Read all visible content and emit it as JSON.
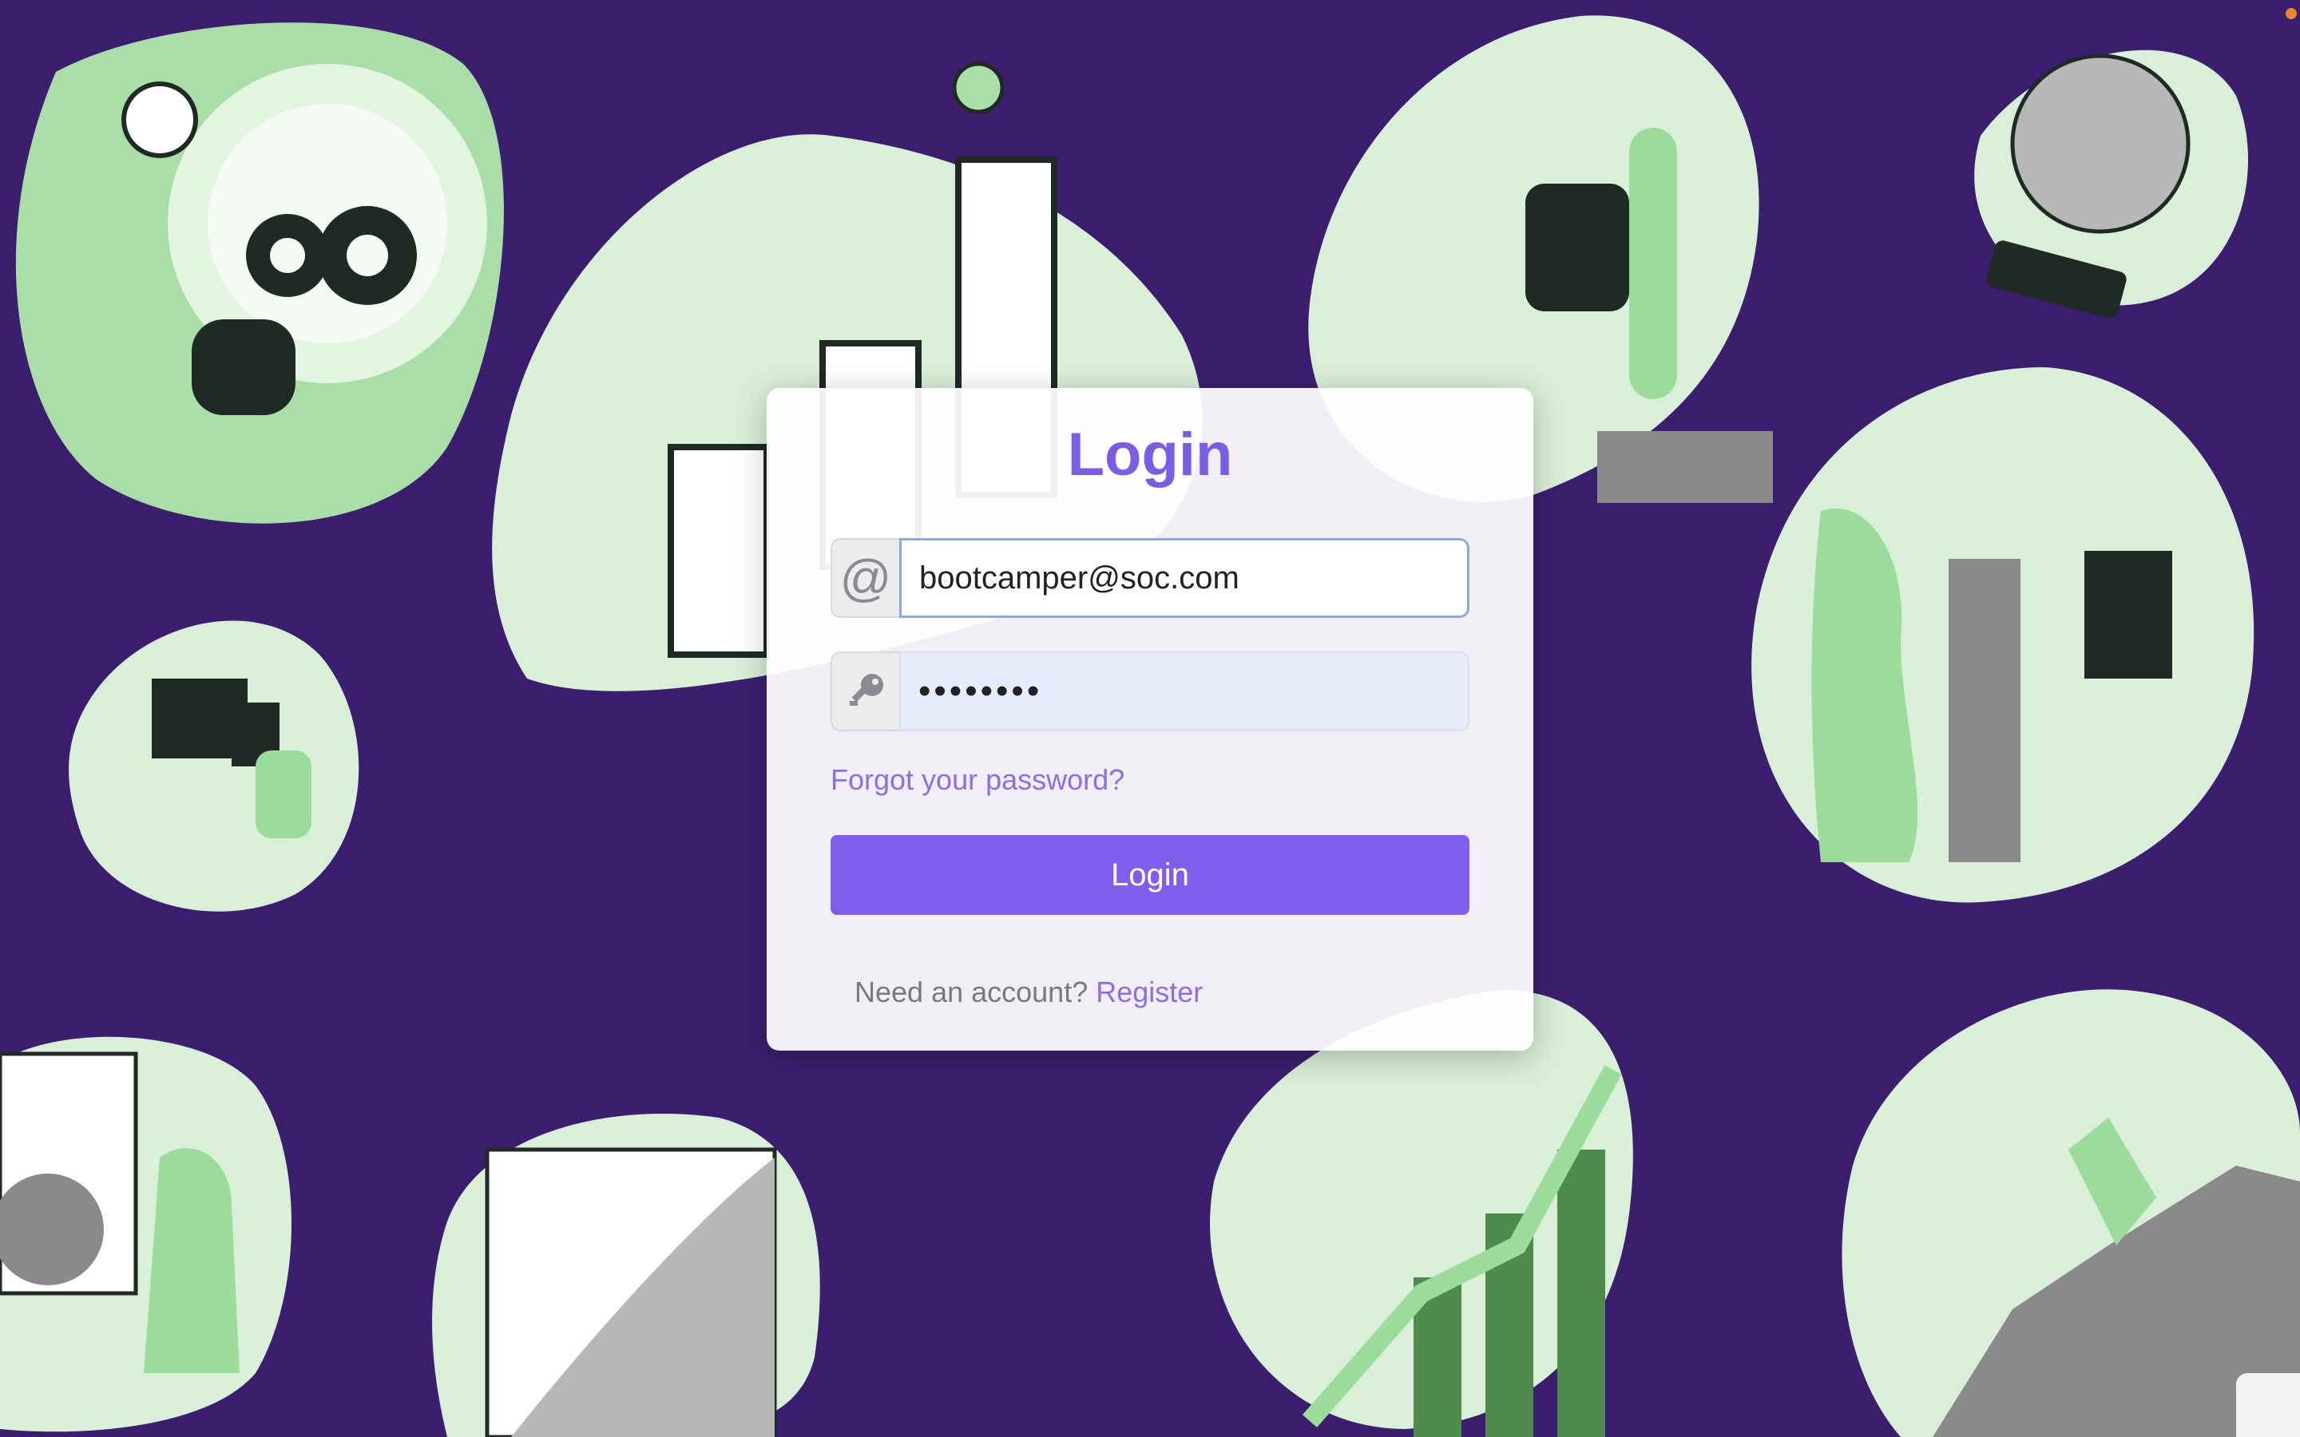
{
  "login": {
    "title": "Login",
    "email": {
      "icon": "at-sign-icon",
      "value": "bootcamper@soc.com"
    },
    "password": {
      "icon": "key-icon",
      "value": "••••••••"
    },
    "forgot_password": "Forgot your password?",
    "submit_label": "Login",
    "need_account": "Need an account?",
    "register_link": "Register"
  },
  "colors": {
    "background": "#3b1f6e",
    "accent": "#7f5ded",
    "illustration_green": "#9bdc9b"
  }
}
